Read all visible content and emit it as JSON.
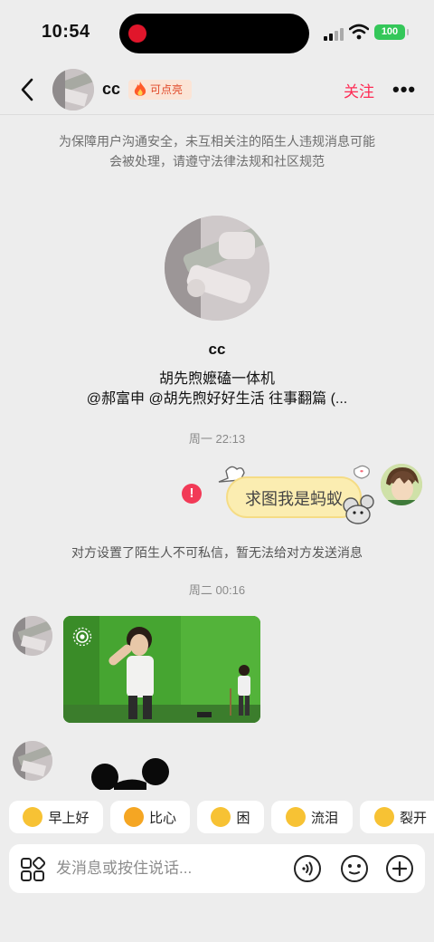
{
  "status": {
    "time": "10:54",
    "battery": "100"
  },
  "header": {
    "name": "cc",
    "badge": "可点亮",
    "follow": "关注",
    "more": "•••"
  },
  "notice": "为保障用户沟通安全，未互相关注的陌生人违规消息可能会被处理，请遵守法律法规和社区规范",
  "profile": {
    "name": "cc",
    "bio_line1": "胡先煦嬷磕一体机",
    "bio_line2": "@郝富申 @胡先煦好好生活 往事翻篇 (..."
  },
  "messages": {
    "time1": "周一 22:13",
    "sticker_text": "求图我是蚂蚁",
    "system_notice": "对方设置了陌生人不可私信，暂无法给对方发送消息",
    "time2": "周二 00:16"
  },
  "quick_replies": [
    {
      "label": "早上好",
      "icon": "sun-face-icon",
      "color": "#f7c234"
    },
    {
      "label": "比心",
      "icon": "heart-hands-icon",
      "color": "#f5a623"
    },
    {
      "label": "困",
      "icon": "sleepy-face-icon",
      "color": "#f7c234"
    },
    {
      "label": "流泪",
      "icon": "crying-face-icon",
      "color": "#f7c234"
    },
    {
      "label": "裂开",
      "icon": "cracked-face-icon",
      "color": "#f7c234"
    }
  ],
  "input": {
    "placeholder": "发消息或按住说话..."
  },
  "colors": {
    "accent": "#fe2c55",
    "background": "#ededed",
    "error": "#f23a57",
    "battery": "#34c759"
  }
}
